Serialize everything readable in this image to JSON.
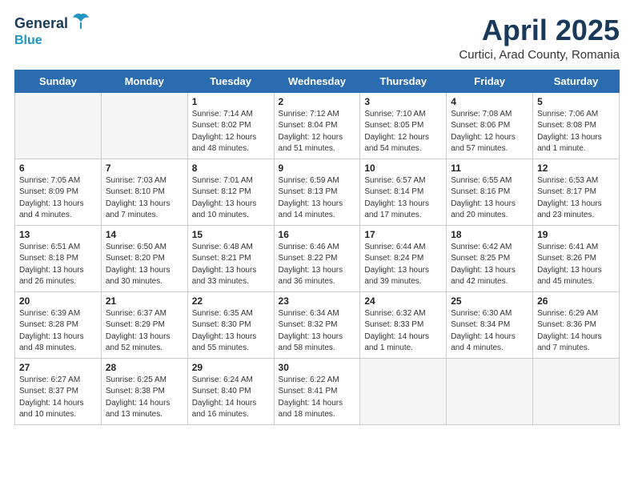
{
  "header": {
    "logo_line1": "General",
    "logo_line2": "Blue",
    "title": "April 2025",
    "subtitle": "Curtici, Arad County, Romania"
  },
  "weekdays": [
    "Sunday",
    "Monday",
    "Tuesday",
    "Wednesday",
    "Thursday",
    "Friday",
    "Saturday"
  ],
  "weeks": [
    [
      {
        "day": "",
        "info": ""
      },
      {
        "day": "",
        "info": ""
      },
      {
        "day": "1",
        "info": "Sunrise: 7:14 AM\nSunset: 8:02 PM\nDaylight: 12 hours and 48 minutes."
      },
      {
        "day": "2",
        "info": "Sunrise: 7:12 AM\nSunset: 8:04 PM\nDaylight: 12 hours and 51 minutes."
      },
      {
        "day": "3",
        "info": "Sunrise: 7:10 AM\nSunset: 8:05 PM\nDaylight: 12 hours and 54 minutes."
      },
      {
        "day": "4",
        "info": "Sunrise: 7:08 AM\nSunset: 8:06 PM\nDaylight: 12 hours and 57 minutes."
      },
      {
        "day": "5",
        "info": "Sunrise: 7:06 AM\nSunset: 8:08 PM\nDaylight: 13 hours and 1 minute."
      }
    ],
    [
      {
        "day": "6",
        "info": "Sunrise: 7:05 AM\nSunset: 8:09 PM\nDaylight: 13 hours and 4 minutes."
      },
      {
        "day": "7",
        "info": "Sunrise: 7:03 AM\nSunset: 8:10 PM\nDaylight: 13 hours and 7 minutes."
      },
      {
        "day": "8",
        "info": "Sunrise: 7:01 AM\nSunset: 8:12 PM\nDaylight: 13 hours and 10 minutes."
      },
      {
        "day": "9",
        "info": "Sunrise: 6:59 AM\nSunset: 8:13 PM\nDaylight: 13 hours and 14 minutes."
      },
      {
        "day": "10",
        "info": "Sunrise: 6:57 AM\nSunset: 8:14 PM\nDaylight: 13 hours and 17 minutes."
      },
      {
        "day": "11",
        "info": "Sunrise: 6:55 AM\nSunset: 8:16 PM\nDaylight: 13 hours and 20 minutes."
      },
      {
        "day": "12",
        "info": "Sunrise: 6:53 AM\nSunset: 8:17 PM\nDaylight: 13 hours and 23 minutes."
      }
    ],
    [
      {
        "day": "13",
        "info": "Sunrise: 6:51 AM\nSunset: 8:18 PM\nDaylight: 13 hours and 26 minutes."
      },
      {
        "day": "14",
        "info": "Sunrise: 6:50 AM\nSunset: 8:20 PM\nDaylight: 13 hours and 30 minutes."
      },
      {
        "day": "15",
        "info": "Sunrise: 6:48 AM\nSunset: 8:21 PM\nDaylight: 13 hours and 33 minutes."
      },
      {
        "day": "16",
        "info": "Sunrise: 6:46 AM\nSunset: 8:22 PM\nDaylight: 13 hours and 36 minutes."
      },
      {
        "day": "17",
        "info": "Sunrise: 6:44 AM\nSunset: 8:24 PM\nDaylight: 13 hours and 39 minutes."
      },
      {
        "day": "18",
        "info": "Sunrise: 6:42 AM\nSunset: 8:25 PM\nDaylight: 13 hours and 42 minutes."
      },
      {
        "day": "19",
        "info": "Sunrise: 6:41 AM\nSunset: 8:26 PM\nDaylight: 13 hours and 45 minutes."
      }
    ],
    [
      {
        "day": "20",
        "info": "Sunrise: 6:39 AM\nSunset: 8:28 PM\nDaylight: 13 hours and 48 minutes."
      },
      {
        "day": "21",
        "info": "Sunrise: 6:37 AM\nSunset: 8:29 PM\nDaylight: 13 hours and 52 minutes."
      },
      {
        "day": "22",
        "info": "Sunrise: 6:35 AM\nSunset: 8:30 PM\nDaylight: 13 hours and 55 minutes."
      },
      {
        "day": "23",
        "info": "Sunrise: 6:34 AM\nSunset: 8:32 PM\nDaylight: 13 hours and 58 minutes."
      },
      {
        "day": "24",
        "info": "Sunrise: 6:32 AM\nSunset: 8:33 PM\nDaylight: 14 hours and 1 minute."
      },
      {
        "day": "25",
        "info": "Sunrise: 6:30 AM\nSunset: 8:34 PM\nDaylight: 14 hours and 4 minutes."
      },
      {
        "day": "26",
        "info": "Sunrise: 6:29 AM\nSunset: 8:36 PM\nDaylight: 14 hours and 7 minutes."
      }
    ],
    [
      {
        "day": "27",
        "info": "Sunrise: 6:27 AM\nSunset: 8:37 PM\nDaylight: 14 hours and 10 minutes."
      },
      {
        "day": "28",
        "info": "Sunrise: 6:25 AM\nSunset: 8:38 PM\nDaylight: 14 hours and 13 minutes."
      },
      {
        "day": "29",
        "info": "Sunrise: 6:24 AM\nSunset: 8:40 PM\nDaylight: 14 hours and 16 minutes."
      },
      {
        "day": "30",
        "info": "Sunrise: 6:22 AM\nSunset: 8:41 PM\nDaylight: 14 hours and 18 minutes."
      },
      {
        "day": "",
        "info": ""
      },
      {
        "day": "",
        "info": ""
      },
      {
        "day": "",
        "info": ""
      }
    ]
  ]
}
